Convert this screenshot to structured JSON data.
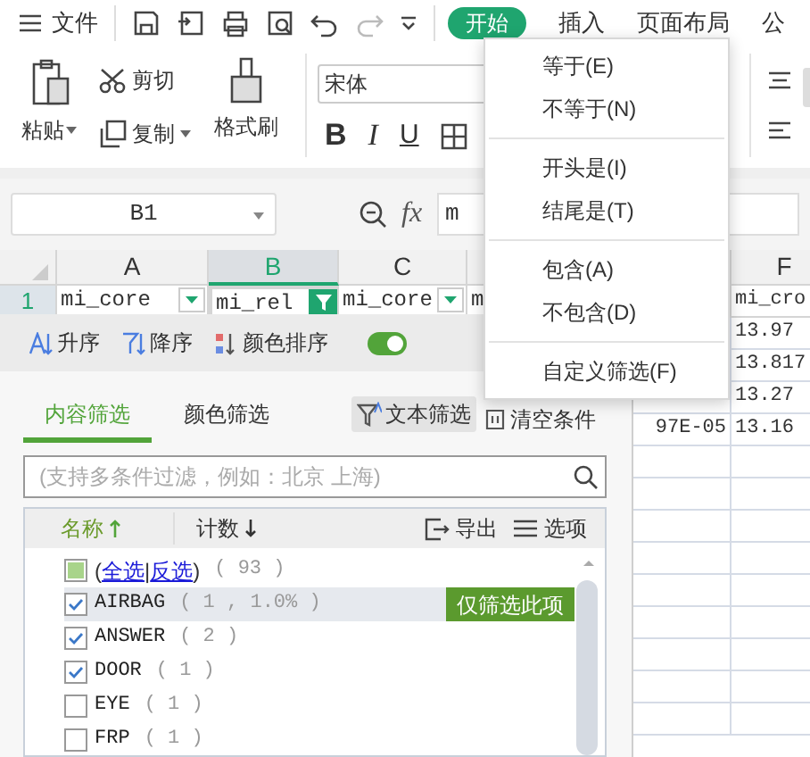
{
  "toolbar": {
    "menu_label": "文件",
    "tabs": [
      {
        "label": "开始",
        "selected": true
      },
      {
        "label": "插入",
        "selected": false
      },
      {
        "label": "页面布局",
        "selected": false
      },
      {
        "label": "公",
        "selected": false
      }
    ]
  },
  "ribbon": {
    "paste": "粘贴",
    "cut": "剪切",
    "copy": "复制",
    "format_painter": "格式刷",
    "font": "宋体",
    "format_buttons": [
      {
        "label": "B",
        "kind": "bold"
      },
      {
        "label": "I",
        "kind": "italic"
      },
      {
        "label": "U",
        "kind": "underline"
      }
    ]
  },
  "formula_bar": {
    "cell_ref": "B1",
    "fx": "fx",
    "value": "m"
  },
  "sheet": {
    "columns": [
      {
        "label": "A",
        "selected": false
      },
      {
        "label": "B",
        "selected": true
      },
      {
        "label": "C",
        "selected": false
      },
      {
        "label": "F",
        "selected": false
      }
    ],
    "header_row": {
      "number": "1",
      "cells": [
        {
          "text": "mi_core",
          "filter_button": true,
          "filter_active": false
        },
        {
          "text": "mi_rel",
          "filter_button": true,
          "filter_active": true
        },
        {
          "text": "mi_core",
          "filter_button": true,
          "filter_active": false
        },
        {
          "text": "m"
        },
        {
          "text": "mi_cro"
        }
      ]
    },
    "rows": [
      {
        "f": "13.97"
      },
      {
        "f": "13.817"
      },
      {
        "f": "13.27"
      },
      {
        "e": "97E-05",
        "f": "13.16"
      }
    ]
  },
  "filter_panel": {
    "sort": [
      {
        "label": "升序",
        "kind": "asc"
      },
      {
        "label": "降序",
        "kind": "desc"
      },
      {
        "label": "颜色排序",
        "kind": "color"
      }
    ],
    "toggle_on": true,
    "tabs": [
      {
        "label": "内容筛选",
        "selected": true
      },
      {
        "label": "颜色筛选",
        "selected": false
      }
    ],
    "text_filter": "文本筛选",
    "clear": "清空条件",
    "search": {
      "placeholder": "(支持多条件过滤，例如：北京 上海)"
    },
    "list_header": {
      "name": "名称",
      "count": "计数",
      "export": "导出",
      "options": "选项"
    },
    "select_all": {
      "open": "(",
      "all": "全选",
      "sep": "|",
      "invert": "反选",
      "close": ")",
      "count": "( 93 )",
      "partial": true
    },
    "items": [
      {
        "name": "AIRBAG",
        "count": "( 1 , 1.0% )",
        "checked": true,
        "hovered": true,
        "only_button": "仅筛选此项"
      },
      {
        "name": "ANSWER",
        "count": "( 2 )",
        "checked": true,
        "hovered": false
      },
      {
        "name": "DOOR",
        "count": "( 1 )",
        "checked": true,
        "hovered": false
      },
      {
        "name": "EYE",
        "count": "( 1 )",
        "checked": false,
        "hovered": false
      },
      {
        "name": "FRP",
        "count": "( 1 )",
        "checked": false,
        "hovered": false
      }
    ]
  },
  "menu": {
    "groups": [
      [
        "等于(E)",
        "不等于(N)"
      ],
      [
        "开头是(I)",
        "结尾是(T)"
      ],
      [
        "包含(A)",
        "不包含(D)"
      ],
      [
        "自定义筛选(F)"
      ]
    ]
  }
}
